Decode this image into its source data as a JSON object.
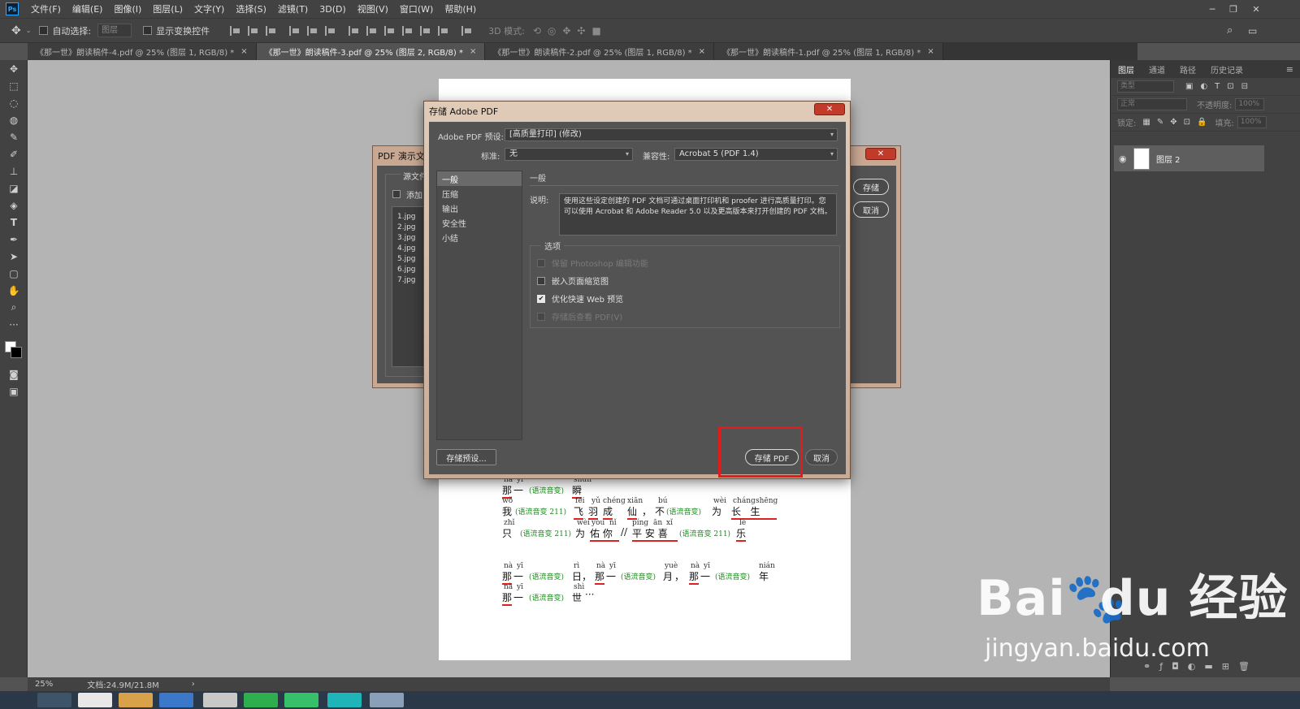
{
  "app": {
    "logo_text": "Ps",
    "menu": [
      "文件(F)",
      "编辑(E)",
      "图像(I)",
      "图层(L)",
      "文字(Y)",
      "选择(S)",
      "滤镜(T)",
      "3D(D)",
      "视图(V)",
      "窗口(W)",
      "帮助(H)"
    ],
    "window_controls": [
      "─",
      "❐",
      "✕"
    ]
  },
  "options_bar": {
    "auto_select_label": "自动选择:",
    "auto_select_value": "图层",
    "show_transform_label": "显示变换控件",
    "mode_3d_label": "3D 模式:"
  },
  "tabs": [
    {
      "label": "《那一世》朗读稿件-4.pdf @ 25% (图层 1, RGB/8) *",
      "close": "×"
    },
    {
      "label": "《那一世》朗读稿件-3.pdf @ 25% (图层 2, RGB/8) *",
      "close": "×"
    },
    {
      "label": "《那一世》朗读稿件-2.pdf @ 25% (图层 1, RGB/8) *",
      "close": "×"
    },
    {
      "label": "《那一世》朗读稿件-1.pdf @ 25% (图层 1, RGB/8) *",
      "close": "×"
    }
  ],
  "layers_panel": {
    "tabs": [
      "图层",
      "通道",
      "路径",
      "历史记录"
    ],
    "kind_placeholder": "类型",
    "blend_mode": "正常",
    "opacity_label": "不透明度:",
    "opacity_value": "100%",
    "lock_label": "锁定:",
    "fill_label": "填充:",
    "fill_value": "100%",
    "layer_name": "图层 2"
  },
  "status": {
    "zoom": "25%",
    "doc_size": "文档:24.9M/21.8M",
    "arrow": "›"
  },
  "back_dialog": {
    "title": "PDF 演示文稿",
    "group_label": "源文件",
    "add_label": "添加",
    "files": [
      "1.jpg",
      "2.jpg",
      "3.jpg",
      "4.jpg",
      "5.jpg",
      "6.jpg",
      "7.jpg"
    ],
    "save_button": "存储",
    "cancel_button": "取消",
    "close": "✕"
  },
  "save_dialog": {
    "title": "存储 Adobe PDF",
    "close": "✕",
    "preset_label": "Adobe PDF 预设:",
    "preset_value": "[高质量打印] (修改)",
    "standard_label": "标准:",
    "standard_value": "无",
    "compat_label": "兼容性:",
    "compat_value": "Acrobat 5 (PDF 1.4)",
    "nav": [
      "一般",
      "压缩",
      "输出",
      "安全性",
      "小结"
    ],
    "section_title": "一般",
    "desc_label": "说明:",
    "description": "使用这些设定创建的 PDF 文档可通过桌面打印机和 proofer 进行高质量打印。您可以使用 Acrobat 和 Adobe Reader 5.0 以及更高版本来打开创建的 PDF 文档。",
    "options_title": "选项",
    "options": [
      {
        "label": "保留 Photoshop 编辑功能",
        "state": "disabled"
      },
      {
        "label": "嵌入页面缩览图",
        "state": "off"
      },
      {
        "label": "优化快速 Web 预览",
        "state": "on"
      },
      {
        "label": "存储后查看 PDF(V)",
        "state": "disabled"
      }
    ],
    "save_preset_button": "存储预设...",
    "save_pdf_button": "存储 PDF",
    "cancel_button": "取消"
  },
  "document_text": {
    "line1": {
      "py": [
        "nà",
        "yī",
        "shùn"
      ],
      "hz": [
        "那",
        "一",
        "瞬"
      ],
      "note": "(语流音变)"
    },
    "line2": {
      "wo_py": "wǒ",
      "wo": "我",
      "note1": "(语流音变 211)",
      "py": [
        "fēi",
        "yǔ",
        "chéng",
        "xiān"
      ],
      "hz": [
        "飞",
        "羽",
        "成",
        "仙"
      ],
      "comma1": "，",
      "bu_py": "bú",
      "bu": "不",
      "note2": "(语流音变)",
      "wei_py": "wèi",
      "wei": "为",
      "cs_py": [
        "cháng",
        "shēng"
      ],
      "cs": [
        "长",
        "生"
      ]
    },
    "line3": {
      "zhi_py": "zhǐ",
      "zhi": "只",
      "note1": "(语流音变 211)",
      "wei_py": "wèi",
      "wei": "为",
      "yn_py": [
        "yòu",
        "nǐ"
      ],
      "yn": [
        "佑",
        "你"
      ],
      "sep": "//",
      "pax_py": [
        "píng",
        "ān",
        "xǐ"
      ],
      "pax": [
        "平",
        "安",
        "喜"
      ],
      "note2": "(语流音变 211)",
      "le_py": "lè",
      "le": "乐"
    },
    "line4": {
      "py1": [
        "nà",
        "yī"
      ],
      "hz1": [
        "那",
        "一"
      ],
      "note": "(语流音变)",
      "ri_py": "rì",
      "ri": "日",
      "comma": "，",
      "yue_py": "yuè",
      "yue": "月",
      "nian_py": "nián",
      "nian": "年"
    },
    "line5": {
      "py": [
        "nà",
        "yī"
      ],
      "hz": [
        "那",
        "一"
      ],
      "note": "(语流音变)",
      "shi_py": "shì",
      "shi": "世",
      "ellipsis": "···"
    }
  },
  "watermark": {
    "brand": "Bai",
    "brand_tail": "du",
    "cn": "经验",
    "url": "jingyan.baidu.com"
  }
}
